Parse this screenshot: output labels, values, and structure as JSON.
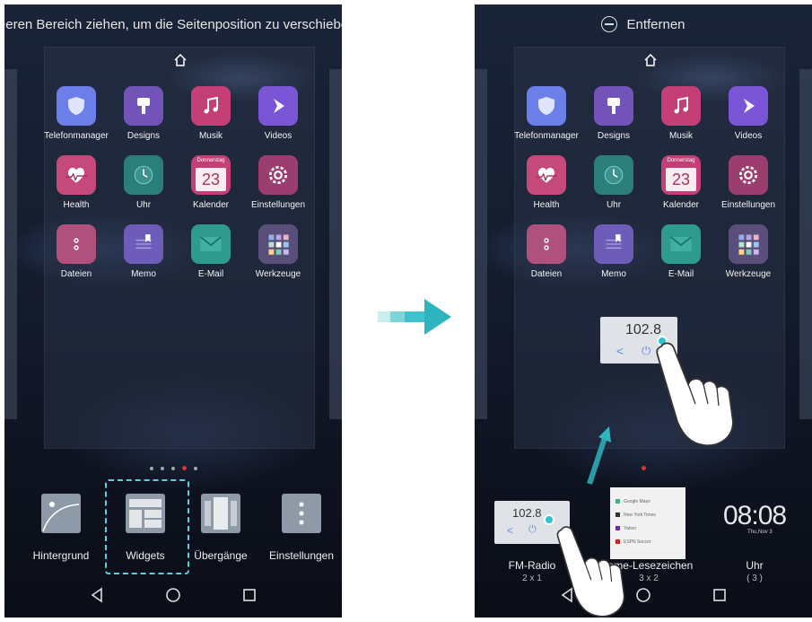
{
  "left_screen": {
    "hint": "Leeren Bereich ziehen, um die Seitenposition zu verschieben",
    "apps": [
      {
        "label": "Telefonmanager",
        "icon": "shield-icon",
        "color": "#6c7ee8"
      },
      {
        "label": "Designs",
        "icon": "brush-icon",
        "color": "#7254b8"
      },
      {
        "label": "Musik",
        "icon": "music-note-icon",
        "color": "#c33f75"
      },
      {
        "label": "Videos",
        "icon": "play-icon",
        "color": "#7a55d6"
      },
      {
        "label": "Health",
        "icon": "heart-icon",
        "color": "#c5497a"
      },
      {
        "label": "Uhr",
        "icon": "clock-icon",
        "color": "#2c7e7a"
      },
      {
        "label": "Kalender",
        "icon": "calendar-icon",
        "color": "#c33f75"
      },
      {
        "label": "Einstellungen",
        "icon": "gear-icon",
        "color": "#9b3e6f"
      },
      {
        "label": "Dateien",
        "icon": "file-icon",
        "color": "#b0507c"
      },
      {
        "label": "Memo",
        "icon": "memo-icon",
        "color": "#6d5db8"
      },
      {
        "label": "E-Mail",
        "icon": "mail-icon",
        "color": "#2f9a8e"
      },
      {
        "label": "Werkzeuge",
        "icon": "folder-icon",
        "color": "#5a4f7a"
      }
    ],
    "calendar": {
      "weekday": "Donnerstag",
      "day": "23"
    },
    "tray": [
      "Hintergrund",
      "Widgets",
      "Übergänge",
      "Einstellungen"
    ]
  },
  "right_screen": {
    "remove_label": "Entfernen",
    "dragged_widget": {
      "freq": "102.8"
    },
    "widgets": [
      {
        "label": "FM-Radio",
        "size": "2 x 1",
        "freq": "102.8"
      },
      {
        "label": "rome-Lesezeichen",
        "size": "3 x 2"
      },
      {
        "label": "Uhr",
        "size": "( 3 )"
      }
    ],
    "bookmarks": [
      "Google Maps",
      "New York Times",
      "Yahoo",
      "ESPN Soccer"
    ],
    "clock": {
      "time": "08:08",
      "date": "Thu,Nov 3"
    }
  },
  "colors": {
    "accent": "#2ec4d0",
    "dashed_border": "#56d4dd",
    "active_dot": "#e53030"
  }
}
